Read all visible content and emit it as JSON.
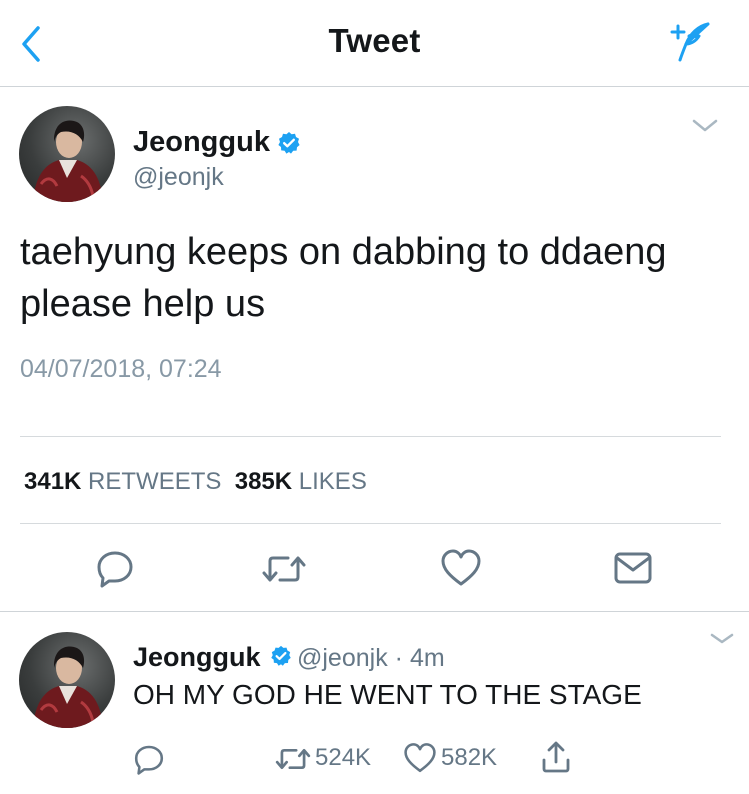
{
  "header": {
    "title": "Tweet",
    "back_icon": "chevron-left-icon",
    "compose_icon": "compose-tweet-icon",
    "accent_color": "#1da1f2"
  },
  "main_tweet": {
    "name": "Jeongguk",
    "handle": "@jeonjk",
    "verified": true,
    "text": "taehyung keeps on dabbing to ddaeng please help us",
    "timestamp": "04/07/2018, 07:24",
    "stats": {
      "retweets_count": "341K",
      "retweets_label": "RETWEETS",
      "likes_count": "385K",
      "likes_label": "LIKES"
    },
    "actions": [
      "reply-icon",
      "retweet-icon",
      "like-icon",
      "direct-message-icon"
    ]
  },
  "reply_tweet": {
    "name": "Jeongguk",
    "handle": "@jeonjk",
    "separator": "·",
    "time": "4m",
    "verified": true,
    "text": "OH MY GOD HE WENT TO THE STAGE",
    "retweets": "524K",
    "likes": "582K",
    "actions": [
      "reply-icon",
      "retweet-icon",
      "like-icon",
      "share-icon"
    ]
  },
  "colors": {
    "verified": "#1da1f2",
    "secondary_text": "#657786",
    "timestamp_text": "#8899a6",
    "divider": "#d6dadd"
  }
}
